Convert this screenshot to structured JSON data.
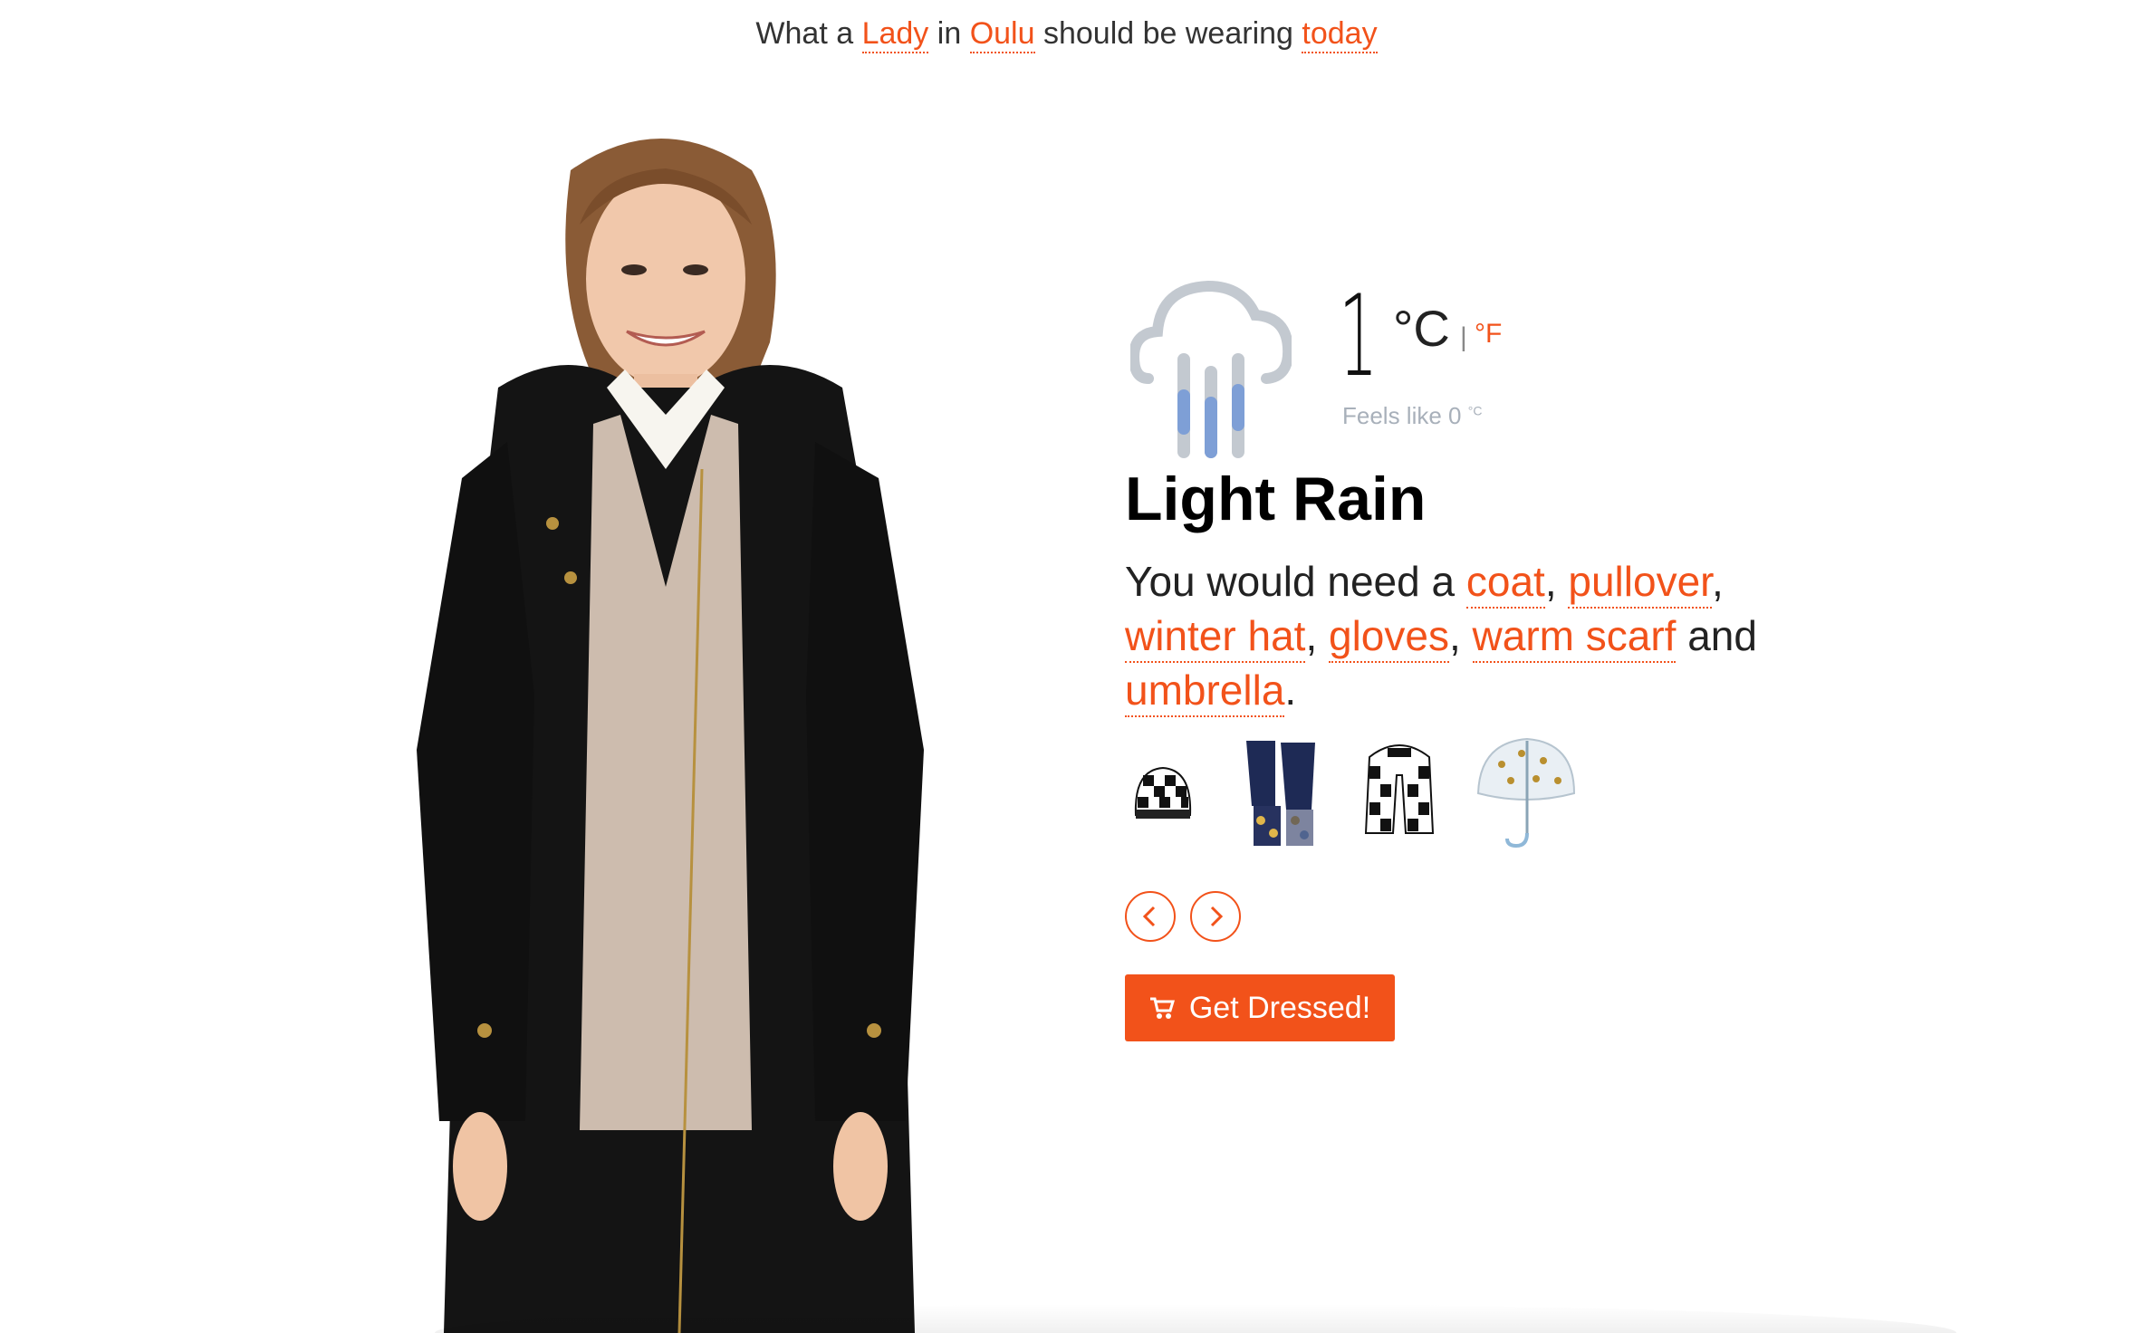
{
  "header": {
    "prefix": "What a",
    "person": "Lady",
    "in_word": "in",
    "city": "Oulu",
    "middle": "should be wearing",
    "day": "today"
  },
  "weather": {
    "temperature": "1",
    "unit": "°C",
    "separator": "|",
    "alt_unit": "°F",
    "feels_like_label": "Feels like 0",
    "feels_like_unit": "°C",
    "condition": "Light Rain",
    "icon": "cloud-rain-icon"
  },
  "advice": {
    "intro": "You would need a",
    "items": [
      "coat",
      "pullover",
      "winter hat",
      "gloves",
      "warm scarf",
      "umbrella"
    ],
    "sep": ",",
    "and": "and",
    "end": "."
  },
  "thumbnails": [
    "beanie-icon",
    "gloves-icon",
    "scarf-icon",
    "umbrella-icon"
  ],
  "nav": {
    "prev_icon": "chevron-left-icon",
    "next_icon": "chevron-right-icon"
  },
  "cta": {
    "label": "Get Dressed!",
    "icon": "cart-icon"
  },
  "colors": {
    "accent": "#f2521a",
    "muted": "#a8b0ba",
    "icon_grey": "#c3c9d0",
    "icon_blue": "#7e9fd6"
  }
}
